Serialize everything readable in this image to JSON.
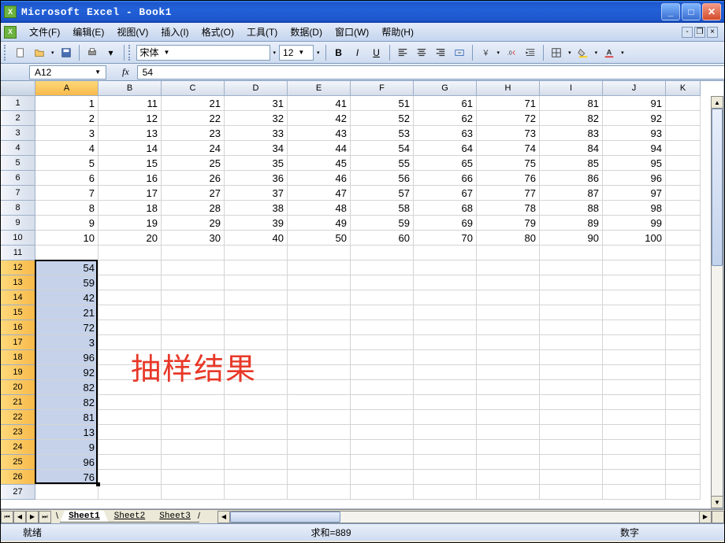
{
  "window": {
    "title": "Microsoft Excel - Book1"
  },
  "menu": {
    "file": "文件(F)",
    "edit": "编辑(E)",
    "view": "视图(V)",
    "insert": "插入(I)",
    "format": "格式(O)",
    "tools": "工具(T)",
    "data": "数据(D)",
    "window": "窗口(W)",
    "help": "帮助(H)"
  },
  "format_toolbar": {
    "font": "宋体",
    "size": "12"
  },
  "formula_bar": {
    "ref": "A12",
    "fx": "fx",
    "formula": "54"
  },
  "columns": [
    "A",
    "B",
    "C",
    "D",
    "E",
    "F",
    "G",
    "H",
    "I",
    "J",
    "K"
  ],
  "rows": [
    "1",
    "2",
    "3",
    "4",
    "5",
    "6",
    "7",
    "8",
    "9",
    "10",
    "11",
    "12",
    "13",
    "14",
    "15",
    "16",
    "17",
    "18",
    "19",
    "20",
    "21",
    "22",
    "23",
    "24",
    "25",
    "26",
    "27"
  ],
  "data_block": [
    [
      1,
      11,
      21,
      31,
      41,
      51,
      61,
      71,
      81,
      91
    ],
    [
      2,
      12,
      22,
      32,
      42,
      52,
      62,
      72,
      82,
      92
    ],
    [
      3,
      13,
      23,
      33,
      43,
      53,
      63,
      73,
      83,
      93
    ],
    [
      4,
      14,
      24,
      34,
      44,
      54,
      64,
      74,
      84,
      94
    ],
    [
      5,
      15,
      25,
      35,
      45,
      55,
      65,
      75,
      85,
      95
    ],
    [
      6,
      16,
      26,
      36,
      46,
      56,
      66,
      76,
      86,
      96
    ],
    [
      7,
      17,
      27,
      37,
      47,
      57,
      67,
      77,
      87,
      97
    ],
    [
      8,
      18,
      28,
      38,
      48,
      58,
      68,
      78,
      88,
      98
    ],
    [
      9,
      19,
      29,
      39,
      49,
      59,
      69,
      79,
      89,
      99
    ],
    [
      10,
      20,
      30,
      40,
      50,
      60,
      70,
      80,
      90,
      100
    ]
  ],
  "sample_values": [
    54,
    59,
    42,
    21,
    72,
    3,
    96,
    92,
    82,
    82,
    81,
    13,
    9,
    96,
    76
  ],
  "annotation_text": "抽样结果",
  "sheet_tabs": {
    "s1": "Sheet1",
    "s2": "Sheet2",
    "s3": "Sheet3"
  },
  "status": {
    "ready": "就绪",
    "sum": "求和=889",
    "num": "数字"
  },
  "active_col": "A",
  "sel_start_row": 12,
  "sel_end_row": 26
}
